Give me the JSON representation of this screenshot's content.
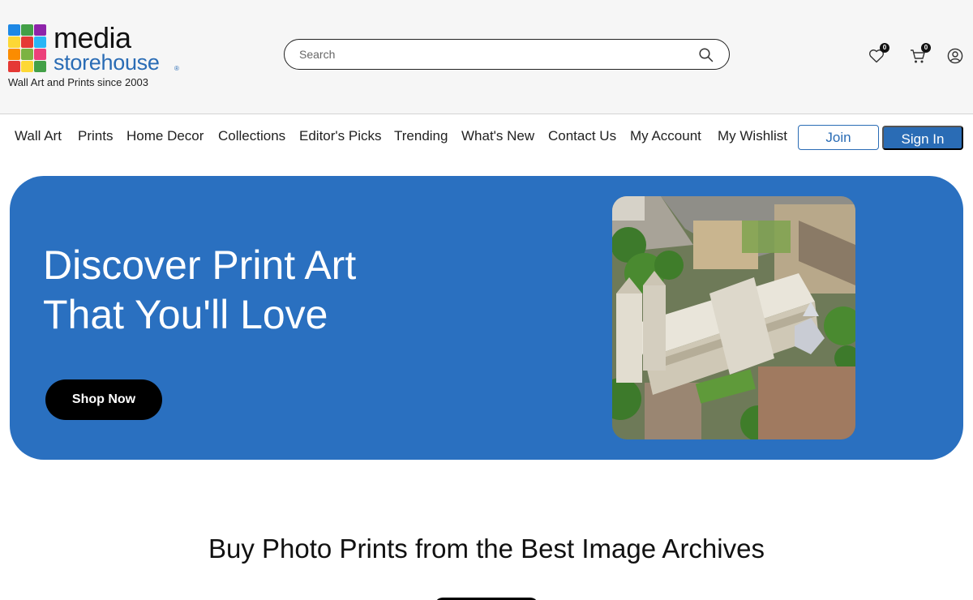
{
  "header": {
    "logo": {
      "line1": "media",
      "line2": "storehouse",
      "registered": "®",
      "tagline": "Wall Art and Prints since 2003"
    },
    "search": {
      "placeholder": "Search",
      "value": ""
    },
    "wishlist": {
      "icon": "heart-icon",
      "count": "0"
    },
    "cart": {
      "icon": "cart-icon",
      "count": "0"
    },
    "account": {
      "icon": "user-icon"
    }
  },
  "nav": {
    "items": [
      "Wall Art",
      "Prints",
      "Home Decor",
      "Collections",
      "Editor's Picks",
      "Trending",
      "What's New",
      "Contact Us",
      "My Account",
      "My Wishlist"
    ],
    "join_label": "Join",
    "signin_label": "Sign In"
  },
  "hero": {
    "title_line1": "Discover Print Art",
    "title_line2": "That You'll Love",
    "button_label": "Shop Now",
    "image": "aerial-westminster-abbey-photo"
  },
  "section": {
    "title": "Buy Photo Prints from the Best Image Archives"
  },
  "colors": {
    "brand_blue": "#2a70c0",
    "accent_blue": "#2a6cb5",
    "header_bg": "#f6f6f6",
    "black": "#000000"
  }
}
